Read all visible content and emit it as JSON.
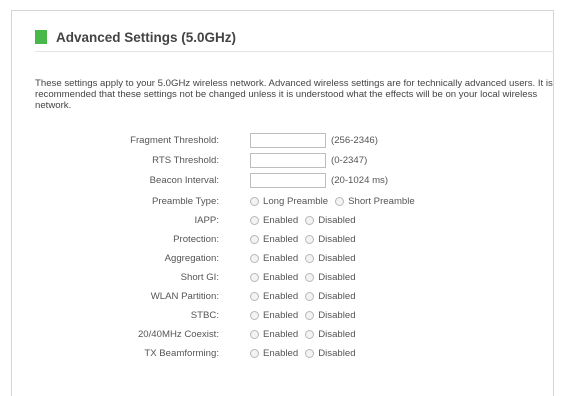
{
  "page": {
    "title": "Advanced Settings (5.0GHz)",
    "intro": "These settings apply to your 5.0GHz wireless network. Advanced wireless settings are for technically advanced users. It is recommended that these settings not be changed unless it is understood what the effects will be on your local wireless network."
  },
  "fields": {
    "fragment": {
      "label": "Fragment Threshold:",
      "value": "",
      "hint": "(256-2346)"
    },
    "rts": {
      "label": "RTS Threshold:",
      "value": "",
      "hint": "(0-2347)"
    },
    "beacon": {
      "label": "Beacon Interval:",
      "value": "",
      "hint": "(20-1024 ms)"
    }
  },
  "preamble": {
    "label": "Preamble Type:",
    "opt1": "Long Preamble",
    "opt2": "Short Preamble"
  },
  "options": {
    "enabled": "Enabled",
    "disabled": "Disabled"
  },
  "radio_rows": {
    "iapp": "IAPP:",
    "protection": "Protection:",
    "aggregation": "Aggregation:",
    "shortgi": "Short GI:",
    "wlan_partition": "WLAN Partition:",
    "stbc": "STBC:",
    "coexist": "20/40MHz Coexist:",
    "beamforming": "TX Beamforming:"
  },
  "colors": {
    "accent": "#48b84a"
  }
}
